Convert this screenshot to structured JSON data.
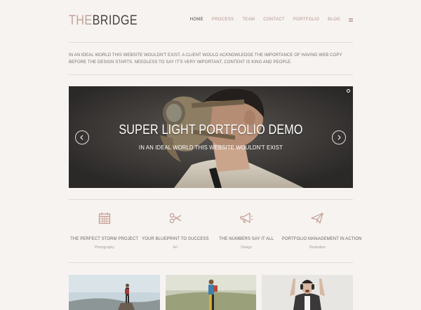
{
  "header": {
    "logo_the": "THE",
    "logo_bridge": "BRIDGE",
    "nav": [
      "HOME",
      "PROCESS",
      "TEAM",
      "CONTACT",
      "PORTFOLIO",
      "BLOG"
    ],
    "active_nav": "HOME"
  },
  "intro": {
    "text": "IN AN IDEAL WORLD THIS WEBSITE WOULDN'T EXIST. A CLIENT WOULD ACKNOWLEDGE THE IMPORTANCE OF HAVING WEB COPY BEFORE THE DESIGN STARTS. NEEDLESS TO SAY IT'S VERY IMPORTANT, CONTENT IS KING AND PEOPLE."
  },
  "slider": {
    "title": "SUPER LIGHT PORTFOLIO DEMO",
    "subtitle": "IN AN IDEAL WORLD THIS WEBSITE WOULDN'T EXIST",
    "prev_icon": "chevron-left-icon",
    "next_icon": "chevron-right-icon"
  },
  "features": [
    {
      "icon": "calendar-icon",
      "title": "THE PERFECT STORM PROJECT",
      "category": "Photography"
    },
    {
      "icon": "scissors-icon",
      "title": "YOUR BLUEPRINT TO SUCCESS",
      "category": "Art"
    },
    {
      "icon": "megaphone-icon",
      "title": "THE NUMBERS SAY IT ALL",
      "category": "Design"
    },
    {
      "icon": "paper-plane-icon",
      "title": "PORTFOLIO MANAGEMENT IN ACTION",
      "category": "Illustration"
    }
  ],
  "colors": {
    "background": "#f6f3f1",
    "accent": "#b59389",
    "logo_dark": "#4a4341",
    "rule": "#e6d9d4"
  }
}
